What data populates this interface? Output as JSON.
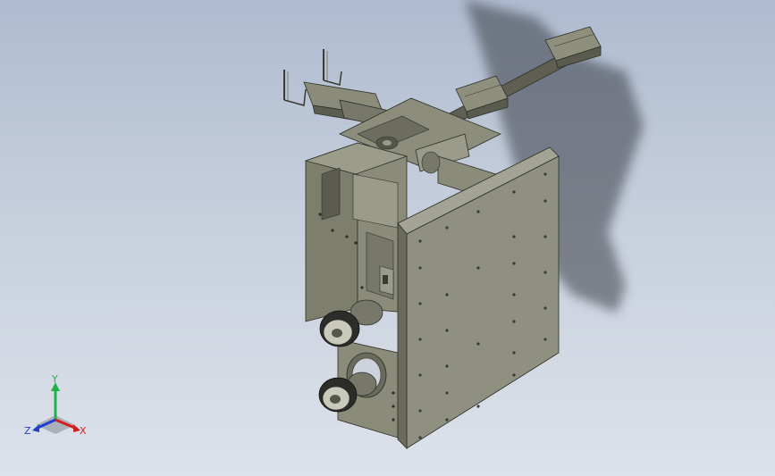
{
  "viewport": {
    "background_top": "#aebbd0",
    "background_bottom": "#dde2ea",
    "model_color": "#7f806e",
    "model_dark": "#55564a",
    "model_light": "#9a9b88"
  },
  "triad": {
    "x_label": "X",
    "y_label": "Y",
    "z_label": "Z",
    "x_color": "#d21f1f",
    "y_color": "#1fb24a",
    "z_color": "#1f3fd2"
  }
}
